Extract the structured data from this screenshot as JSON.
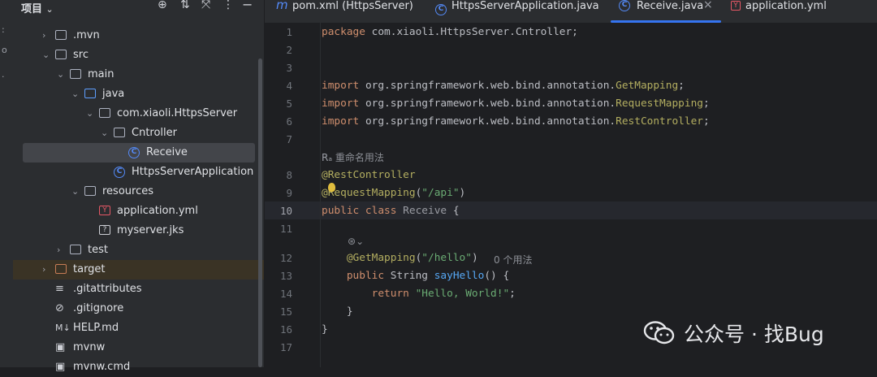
{
  "project": {
    "title": "项目",
    "tree": [
      {
        "label": ".mvn",
        "depth": 1,
        "arrow": "›",
        "icon": "folder"
      },
      {
        "label": "src",
        "depth": 1,
        "arrow": "⌄",
        "icon": "folder"
      },
      {
        "label": "main",
        "depth": 2,
        "arrow": "⌄",
        "icon": "folder"
      },
      {
        "label": "java",
        "depth": 3,
        "arrow": "⌄",
        "icon": "folder-blue"
      },
      {
        "label": "com.xiaoli.HttpsServer",
        "depth": 4,
        "arrow": "⌄",
        "icon": "package"
      },
      {
        "label": "Cntroller",
        "depth": 5,
        "arrow": "⌄",
        "icon": "package"
      },
      {
        "label": "Receive",
        "depth": 6,
        "arrow": "",
        "icon": "class",
        "selected": true
      },
      {
        "label": "HttpsServerApplication",
        "depth": 5,
        "arrow": "",
        "icon": "class"
      },
      {
        "label": "resources",
        "depth": 3,
        "arrow": "⌄",
        "icon": "resources"
      },
      {
        "label": "application.yml",
        "depth": 4,
        "arrow": "",
        "icon": "yml"
      },
      {
        "label": "myserver.jks",
        "depth": 4,
        "arrow": "",
        "icon": "unknown"
      },
      {
        "label": "test",
        "depth": 2,
        "arrow": "›",
        "icon": "folder"
      },
      {
        "label": "target",
        "depth": 1,
        "arrow": "›",
        "icon": "folder-orange",
        "highlight": true
      },
      {
        "label": ".gitattributes",
        "depth": 1,
        "arrow": "",
        "icon": "lines"
      },
      {
        "label": ".gitignore",
        "depth": 1,
        "arrow": "",
        "icon": "ignore"
      },
      {
        "label": "HELP.md",
        "depth": 1,
        "arrow": "",
        "icon": "md"
      },
      {
        "label": "mvnw",
        "depth": 1,
        "arrow": "",
        "icon": "terminal"
      },
      {
        "label": "mvnw.cmd",
        "depth": 1,
        "arrow": "",
        "icon": "terminal"
      }
    ]
  },
  "tabs": [
    {
      "label": "pom.xml (HttpsServer)",
      "icon": "m"
    },
    {
      "label": "HttpsServerApplication.java",
      "icon": "class"
    },
    {
      "label": "Receive.java",
      "icon": "class",
      "active": true,
      "close": "×"
    },
    {
      "label": "application.yml",
      "icon": "yml"
    }
  ],
  "editor": {
    "current_line": 10,
    "line_numbers": [
      "1",
      "2",
      "3",
      "4",
      "5",
      "6",
      "7",
      "8",
      "9",
      "10",
      "11",
      "12",
      "13",
      "14",
      "15",
      "16",
      "17"
    ],
    "hints": {
      "rename_usages": "重命名用法",
      "zero_usages": "0 个用法"
    }
  },
  "colors": {
    "keyword": "#cf8e6d",
    "annotation": "#b3ae60",
    "string": "#6aab73",
    "function": "#56a8f5",
    "accent": "#3574f0"
  },
  "watermark": {
    "text": "公众号 · 找Bug"
  }
}
